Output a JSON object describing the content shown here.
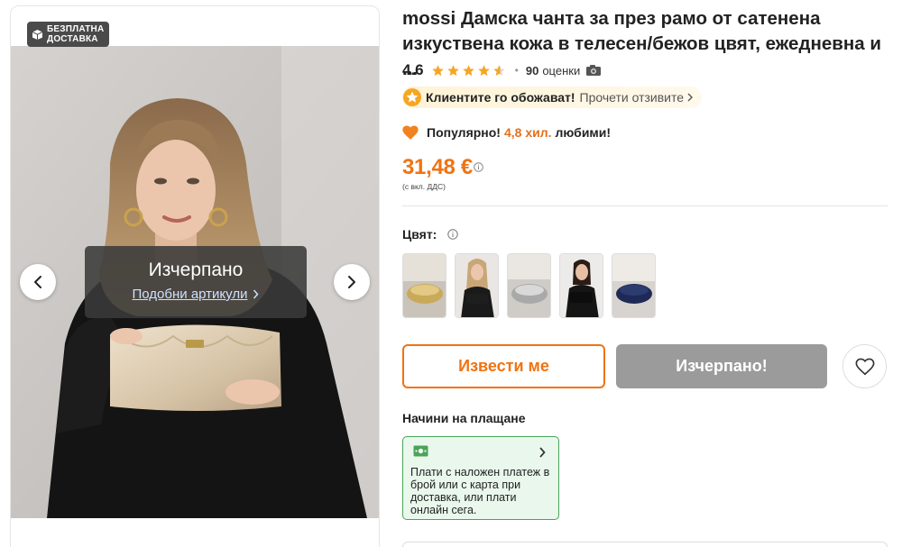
{
  "gallery": {
    "badge_line1": "БЕЗПЛАТНА",
    "badge_line2": "ДОСТАВКА",
    "soldout_title": "Изчерпано",
    "similar_link": "Подобни артикули"
  },
  "product": {
    "brand": "mossi",
    "title": " Дамска чанта за през рамо от сатенена изкуствена кожа в телесен/бежов цвят, ежедневна и ...",
    "rating": "4.6",
    "rating_value": 4.6,
    "reviews_count": "90",
    "reviews_label": "оценки",
    "love_strong": "Клиентите го обожават!",
    "love_link": "Прочети отзивите",
    "popular_pre": "Популярно!",
    "popular_highlight": "4,8 хил.",
    "popular_post": "любими!",
    "price": "31,48 €",
    "vat_note": "(с вкл. ДДС)",
    "color_label": "Цвят:"
  },
  "actions": {
    "notify_label": "Извести ме",
    "soldout_label": "Изчерпано!"
  },
  "payment": {
    "title": "Начини на плащане",
    "description": "Плати с наложен платеж в брой или с карта при доставка, или плати онлайн сега."
  },
  "colors": {
    "accent": "#f07312",
    "star": "#f5a623",
    "pay_border": "#4aa358",
    "pay_bg": "#e9f7ec",
    "soldout_btn": "#9b9b9b"
  }
}
